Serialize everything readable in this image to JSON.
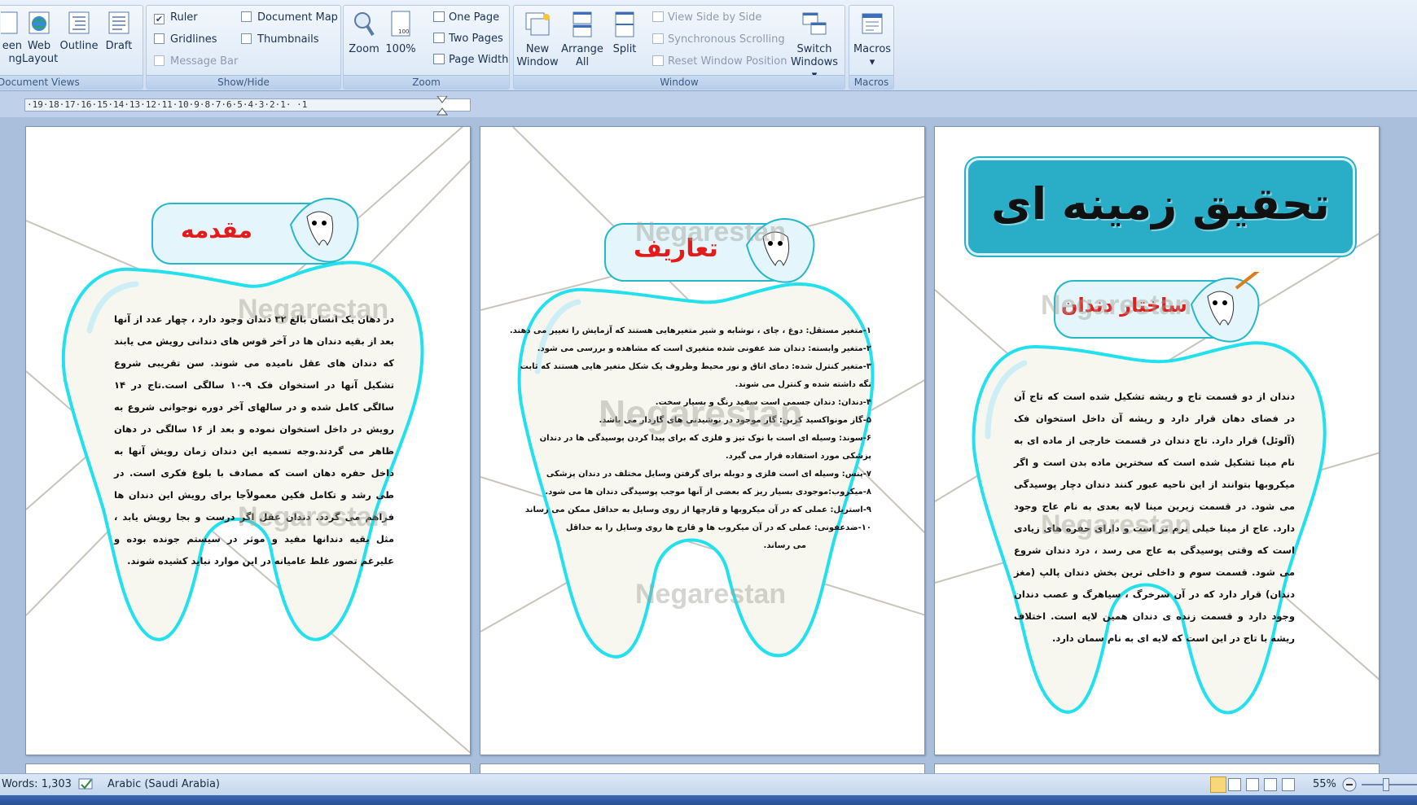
{
  "ribbon": {
    "document_views": {
      "label": "Document Views",
      "items": [
        {
          "label": "een\nng",
          "icon": "full-screen-icon"
        },
        {
          "label": "Web\nLayout",
          "icon": "web-layout-icon"
        },
        {
          "label": "Outline",
          "icon": "outline-icon"
        },
        {
          "label": "Draft",
          "icon": "draft-icon"
        }
      ]
    },
    "show_hide": {
      "label": "Show/Hide",
      "ruler": "Ruler",
      "ruler_checked": true,
      "gridlines": "Gridlines",
      "message_bar": "Message Bar",
      "document_map": "Document Map",
      "thumbnails": "Thumbnails"
    },
    "zoom": {
      "label": "Zoom",
      "zoom_btn": "Zoom",
      "hundred_btn": "100%",
      "one_page": "One Page",
      "two_pages": "Two Pages",
      "page_width": "Page Width"
    },
    "window": {
      "label": "Window",
      "new_window": "New\nWindow",
      "arrange_all": "Arrange\nAll",
      "split": "Split",
      "view_side_by_side": "View Side by Side",
      "synchronous_scrolling": "Synchronous Scrolling",
      "reset_window_position": "Reset Window Position",
      "switch_windows": "Switch\nWindows ▾"
    },
    "macros": {
      "label": "Macros",
      "macros_btn": "Macros\n▾"
    }
  },
  "ruler": {
    "numbers": "·19·18·17·16·15·14·13·12·11·10·9·8·7·6·5·4·3·2·1·  ·1"
  },
  "pages": {
    "page1": {
      "title": "تحقیق زمینه ای",
      "section_label": "ساختار دندان",
      "watermark": "Negarestan",
      "text": "دندان از دو قسمت تاج و ریشه تشکیل شده است که تاج آن در فضای دهان قرار دارد و ریشه آن داخل استخوان فک (آلوئل) قرار دارد. تاج دندان در قسمت خارجی از ماده ای به نام مینا تشکیل شده است که سخترین ماده بدن است و اگر میکروبها بتوانند از این ناحیه عبور کنند دندان دچار پوسیدگی می شود. در قسمت زیرین مینا لایه بعدی به نام عاج وجود دارد. عاج از مینا خیلی نرم تر است و دارای حفره های زیادی است که وقتی پوسیدگی به عاج می رسد ، درد دندان شروع می شود. قسمت سوم و داخلی ترین بخش دندان پالپ (مغز دندان) قرار دارد که در آن سرخرگ ، سیاهرگ و عصب دندان وجود دارد و قسمت زنده ی دندان همین لایه است. اختلاف ریشه با تاج در این است که لایه ای به نام سمان دارد."
    },
    "page2": {
      "section_label": "تعاریف",
      "watermark": "Negarestan",
      "lines": [
        "۱-متغیر مستقل: دوغ ، چای ، نوشابه و شیر متغیرهایی هستند که آزمایش را تغییر می دهند.",
        "۲-متغیر وابسته: دندان ضد عفونی شده متغیری است که مشاهده و بررسی می شود.",
        "۳-متغیر کنترل شده: دمای اتاق و نور محیط وظروف یک شکل متغیر هایی هستند که ثابت",
        "نگه داشته شده و کنترل می شوند.",
        "۴-دندان: دندان جسمی است سفید رنگ و بسیار سخت.",
        "۵-گاز مونواکسید کربن: گاز موجود در نوشیدنی های گازدار می باشد.",
        "۶-سوند: وسیله ای است با نوک تیز و فلزی که برای پیدا کردن پوسیدگی ها در دندان",
        "پزشکی مورد استفاده قرار می گیرد.",
        "۷-پنس: وسیله ای است فلزی و دوبله برای گرفتن وسایل مختلف در دندان پزشکی",
        "۸-میکروب:موجودی بسیار ریز که بعضی از آنها موجب پوسیدگی دندان ها می شود.",
        "۹-استریل: عملی که در آن میکروبها و قارچها از روی وسایل به حداقل ممکن می رساند",
        "۱۰-ضدعفونی: عملی که در آن میکروب ها و قارچ ها روی وسایل را به حداقل",
        "می رساند."
      ]
    },
    "page3": {
      "section_label": "مقدمه",
      "watermark": "Negarestan",
      "text": "در دهان یک انسان بالغ ۳۲ دندان وجود دارد ، چهار عدد از آنها بعد از بقیه دندان ها در آخر قوس های دندانی رویش می یابند که دندان های عقل نامیده می شوند. سن تقریبی شروع تشکیل آنها در استخوان فک ۹-۱۰ سالگی است.تاج در ۱۴ سالگی کامل شده و در سالهای آخر دوره نوجوانی شروع به رویش در داخل استخوان نموده و بعد از ۱۶ سالگی در دهان ظاهر می گردند.وجه تسمیه این دندان زمان رویش آنها به داخل حفره دهان است که مصادف با بلوغ فکری است. در طی رشد و تکامل فکین معمولاًجا برای رویش این دندان ها فراهم می گردد. دندان عقل اگر درست و بجا رویش یابد ، مثل بقیه دندانها مفید و موثر در سیستم جونده بوده و علیرغم تصور غلط عامیانه در این موارد نباید کشیده شوند."
    }
  },
  "statusbar": {
    "words": "Words: 1,303",
    "language": "Arabic (Saudi Arabia)",
    "zoom": "55%"
  },
  "colors": {
    "tooth_outline": "#22e1ec",
    "tooth_fill": "#f8f7ef",
    "title_bg": "#2aaec7",
    "label_red": "#e31b1b"
  }
}
